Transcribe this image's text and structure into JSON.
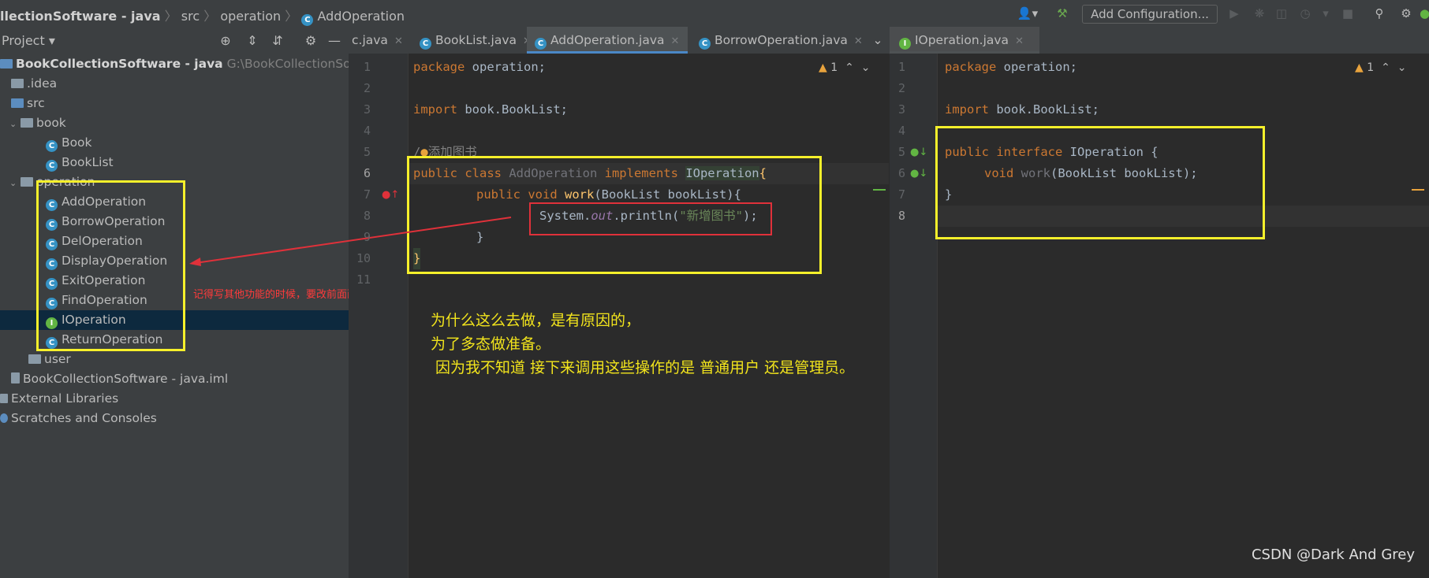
{
  "breadcrumb": {
    "project": "llectionSoftware - java",
    "src": "src",
    "pkg": "operation",
    "cls": "AddOperation"
  },
  "toolbar": {
    "add_config": "Add Configuration..."
  },
  "project_panel": {
    "title": "Project",
    "root_name": "BookCollectionSoftware - java",
    "root_path": "G:\\BookCollectionSoftware",
    "idea": ".idea",
    "src": "src",
    "book_pkg": "book",
    "book_items": [
      "Book",
      "BookList"
    ],
    "operation_pkg": "operation",
    "operation_items": [
      "AddOperation",
      "BorrowOperation",
      "DelOperation",
      "DisplayOperation",
      "ExitOperation",
      "FindOperation",
      "IOperation",
      "ReturnOperation"
    ],
    "user_pkg": "user",
    "iml": "BookCollectionSoftware - java.iml",
    "external": "External Libraries",
    "scratches": "Scratches and Consoles"
  },
  "tabs": {
    "t0": "c.java",
    "t1": "BookList.java",
    "t2": "AddOperation.java",
    "t3": "BorrowOperation.java",
    "t4": "IOperation.java"
  },
  "left_editor": {
    "line_numbers": [
      "1",
      "2",
      "3",
      "4",
      "5",
      "6",
      "7",
      "8",
      "9",
      "10",
      "11"
    ],
    "warning_count": "1",
    "l1_kw": "package",
    "l1_rest": " operation;",
    "l3_kw": "import",
    "l3_rest": " book.BookList;",
    "l5": "添加图书",
    "l6_kw1": "public class",
    "l6_cls": " AddOperation ",
    "l6_kw2": "implements",
    "l6_iface": "IOperation",
    "l6_brace": "{",
    "l7_kw": "public void",
    "l7_fn": "work",
    "l7_rest": "(BookList bookList){",
    "l8_a": "System.",
    "l8_out": "out",
    "l8_b": ".println(",
    "l8_str": "\"新增图书\"",
    "l8_c": ");",
    "l9": "}",
    "l10": "}"
  },
  "right_editor": {
    "line_numbers": [
      "1",
      "2",
      "3",
      "4",
      "5",
      "6",
      "7",
      "8"
    ],
    "warning_count": "1",
    "l1_kw": "package",
    "l1_rest": " operation;",
    "l3_kw": "import",
    "l3_rest": " book.BookList;",
    "l5_kw": "public interface",
    "l5_rest": " IOperation {",
    "l6_kw": "void",
    "l6_fn": " work",
    "l6_rest": "(BookList bookList);",
    "l7": "}"
  },
  "annotations": {
    "red_note": "记得写其他功能的时候，要改前面两个字",
    "note_lines": [
      "为什么这么去做，是有原因的，",
      "为了多态做准备。",
      " 因为我不知道 接下来调用这些操作的是 普通用户 还是管理员。"
    ],
    "watermark": "CSDN @Dark And Grey"
  }
}
